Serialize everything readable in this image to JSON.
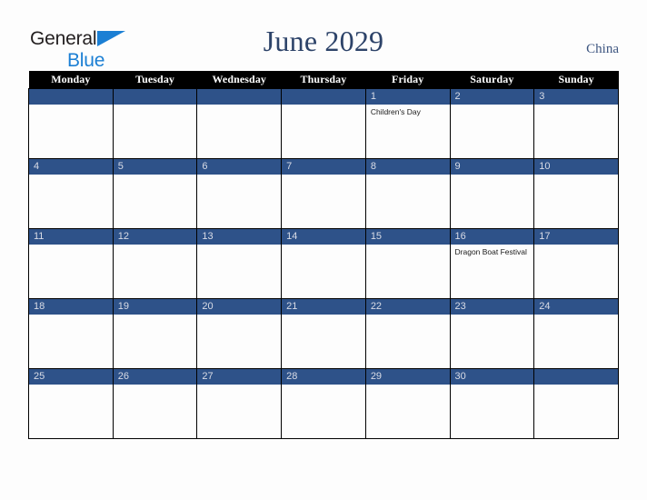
{
  "brand": {
    "line1": "General",
    "line2": "Blue",
    "triangle_color": "#1b7fd4",
    "text_color": "#231f20"
  },
  "header": {
    "title": "June 2029",
    "country": "China",
    "title_color": "#2d4369"
  },
  "colors": {
    "header_row_bg": "#000000",
    "header_row_text": "#ffffff",
    "day_bar_bg": "#2e5289",
    "day_number_text": "#d9dce6",
    "cell_bg": "#fdfdfd",
    "page_bg": "#fdfdfd",
    "grid_line": "#000000"
  },
  "weekdays": [
    "Monday",
    "Tuesday",
    "Wednesday",
    "Thursday",
    "Friday",
    "Saturday",
    "Sunday"
  ],
  "weeks": [
    [
      {
        "day": "",
        "events": []
      },
      {
        "day": "",
        "events": []
      },
      {
        "day": "",
        "events": []
      },
      {
        "day": "",
        "events": []
      },
      {
        "day": "1",
        "events": [
          "Children's Day"
        ]
      },
      {
        "day": "2",
        "events": []
      },
      {
        "day": "3",
        "events": []
      }
    ],
    [
      {
        "day": "4",
        "events": []
      },
      {
        "day": "5",
        "events": []
      },
      {
        "day": "6",
        "events": []
      },
      {
        "day": "7",
        "events": []
      },
      {
        "day": "8",
        "events": []
      },
      {
        "day": "9",
        "events": []
      },
      {
        "day": "10",
        "events": []
      }
    ],
    [
      {
        "day": "11",
        "events": []
      },
      {
        "day": "12",
        "events": []
      },
      {
        "day": "13",
        "events": []
      },
      {
        "day": "14",
        "events": []
      },
      {
        "day": "15",
        "events": []
      },
      {
        "day": "16",
        "events": [
          "Dragon Boat Festival"
        ]
      },
      {
        "day": "17",
        "events": []
      }
    ],
    [
      {
        "day": "18",
        "events": []
      },
      {
        "day": "19",
        "events": []
      },
      {
        "day": "20",
        "events": []
      },
      {
        "day": "21",
        "events": []
      },
      {
        "day": "22",
        "events": []
      },
      {
        "day": "23",
        "events": []
      },
      {
        "day": "24",
        "events": []
      }
    ],
    [
      {
        "day": "25",
        "events": []
      },
      {
        "day": "26",
        "events": []
      },
      {
        "day": "27",
        "events": []
      },
      {
        "day": "28",
        "events": []
      },
      {
        "day": "29",
        "events": []
      },
      {
        "day": "30",
        "events": []
      },
      {
        "day": "",
        "events": []
      }
    ]
  ]
}
